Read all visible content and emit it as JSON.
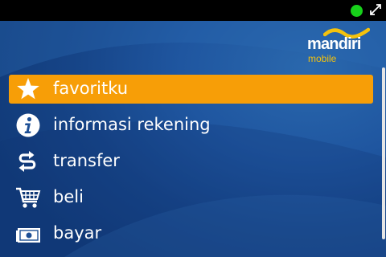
{
  "status_bar": {
    "signal_color": "#17d11a",
    "icons": [
      "status-dot-icon",
      "expand-arrows-icon"
    ]
  },
  "logo": {
    "name": "mandiri",
    "subtitle": "mobile"
  },
  "menu": {
    "selected_index": 0,
    "items": [
      {
        "label": "favoritku",
        "icon": "star-icon"
      },
      {
        "label": "informasi rekening",
        "icon": "info-icon"
      },
      {
        "label": "transfer",
        "icon": "transfer-icon"
      },
      {
        "label": "beli",
        "icon": "shopping-cart-icon"
      },
      {
        "label": "bayar",
        "icon": "cash-icon"
      }
    ]
  },
  "colors": {
    "selection": "#f79e07",
    "background": "#1f56a0",
    "logo_accent": "#f4c20d"
  }
}
